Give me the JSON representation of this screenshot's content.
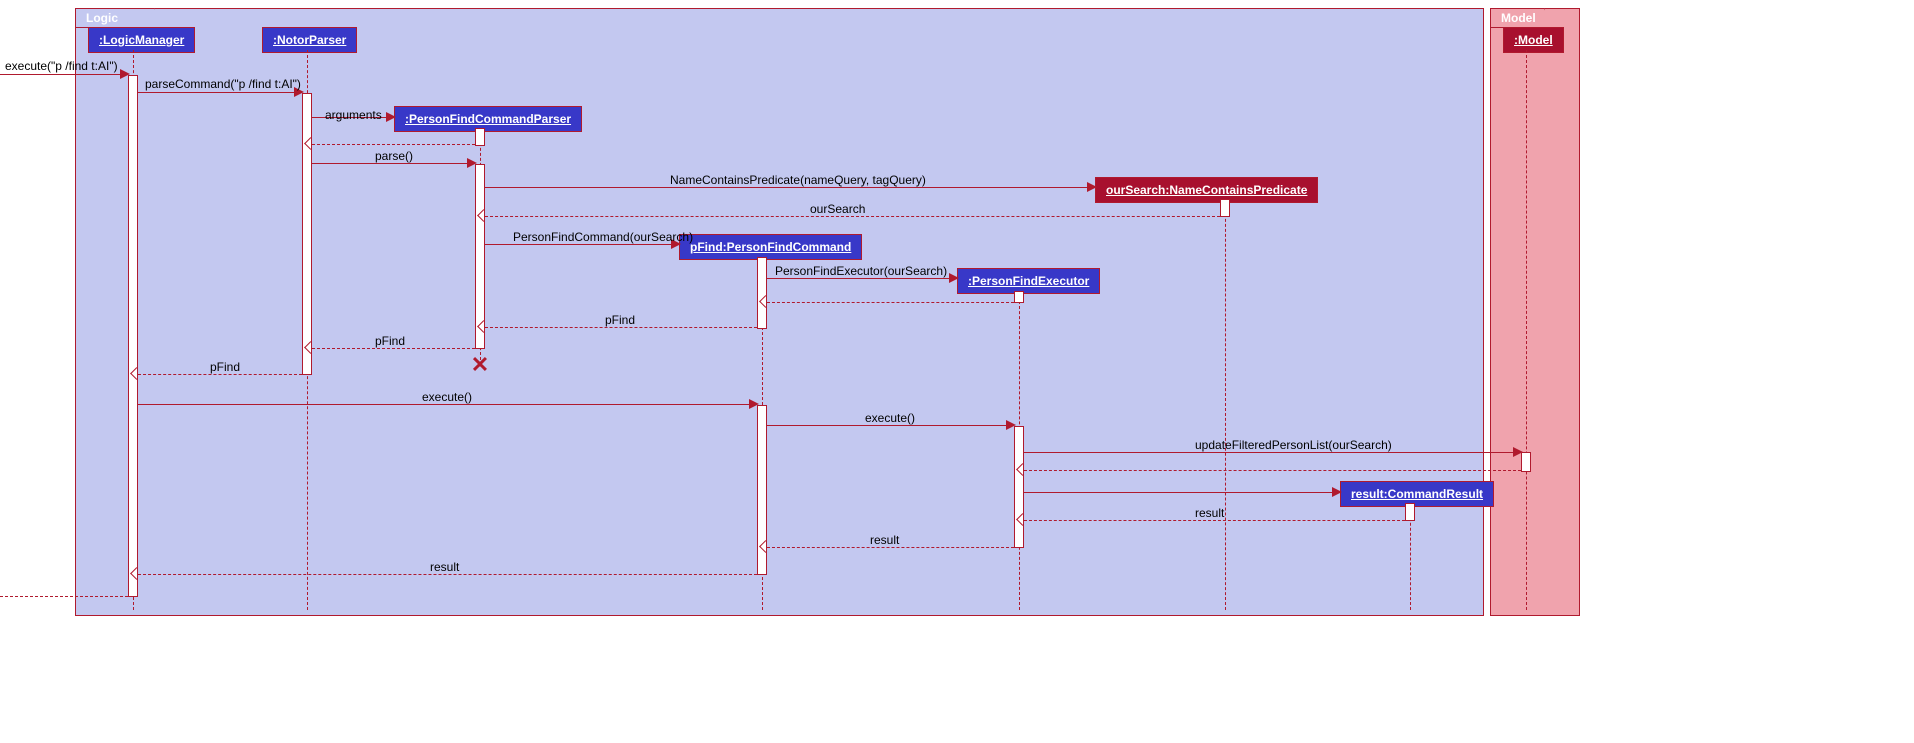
{
  "frames": {
    "logic": "Logic",
    "model": "Model"
  },
  "participants": {
    "logicManager": ":LogicManager",
    "notorParser": ":NotorParser",
    "personFindCommandParser": ":PersonFindCommandParser",
    "personFindCommand": "pFind:PersonFindCommand",
    "personFindExecutor": ":PersonFindExecutor",
    "nameContainsPredicate": "ourSearch:NameContainsPredicate",
    "commandResult": "result:CommandResult",
    "model": ":Model"
  },
  "messages": {
    "execute1": "execute(\"p /find t:AI\")",
    "parseCommand": "parseCommand(\"p /find t:AI\")",
    "arguments": "arguments",
    "parse": "parse()",
    "nameContainsPredicate": "NameContainsPredicate(nameQuery, tagQuery)",
    "ourSearch": "ourSearch",
    "personFindCommand": "PersonFindCommand(ourSearch)",
    "personFindExecutor": "PersonFindExecutor(ourSearch)",
    "pFind": "pFind",
    "execute2": "execute()",
    "updateFilteredPersonList": "updateFilteredPersonList(ourSearch)",
    "result": "result"
  }
}
